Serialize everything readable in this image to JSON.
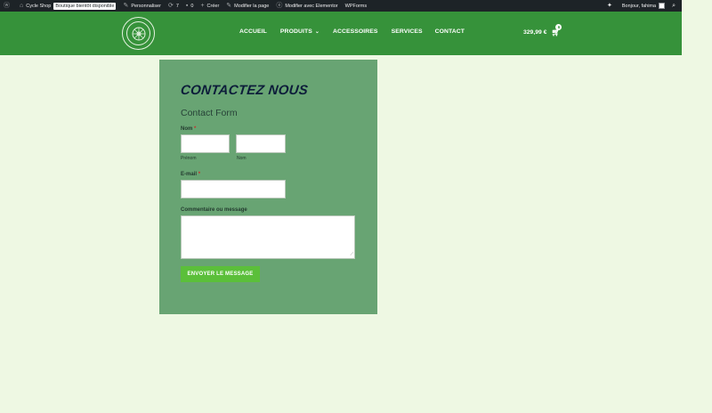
{
  "adminbar": {
    "site_name": "Cycle Shop",
    "badge": "Boutique bientôt disponible",
    "customize": "Personnaliser",
    "updates_count": "7",
    "comments_count": "0",
    "new_label": "Créer",
    "edit_page": "Modifier la page",
    "edit_elementor": "Modifier avec Elementor",
    "wpforms": "WPForms",
    "greeting": "Bonjour, fahima"
  },
  "header": {
    "nav": [
      {
        "label": "ACCUEIL"
      },
      {
        "label": "PRODUITS"
      },
      {
        "label": "ACCESSOIRES"
      },
      {
        "label": "SERVICES"
      },
      {
        "label": "CONTACT"
      }
    ],
    "cart_total": "329,99 €",
    "cart_count": "6"
  },
  "panel": {
    "title": "CONTACTEZ NOUS",
    "form_title": "Contact Form",
    "name_label": "Nom",
    "required_mark": "*",
    "first_name_sublabel": "Prénom",
    "last_name_sublabel": "Nom",
    "email_label": "E-mail",
    "message_label": "Commentaire ou message",
    "submit_label": "ENVOYER LE MESSAGE"
  },
  "colors": {
    "header_bg": "#36923a",
    "panel_bg": "#68a473",
    "page_bg": "#eef8e3",
    "button_bg": "#5bbf3a",
    "adminbar_bg": "#1d2327"
  }
}
